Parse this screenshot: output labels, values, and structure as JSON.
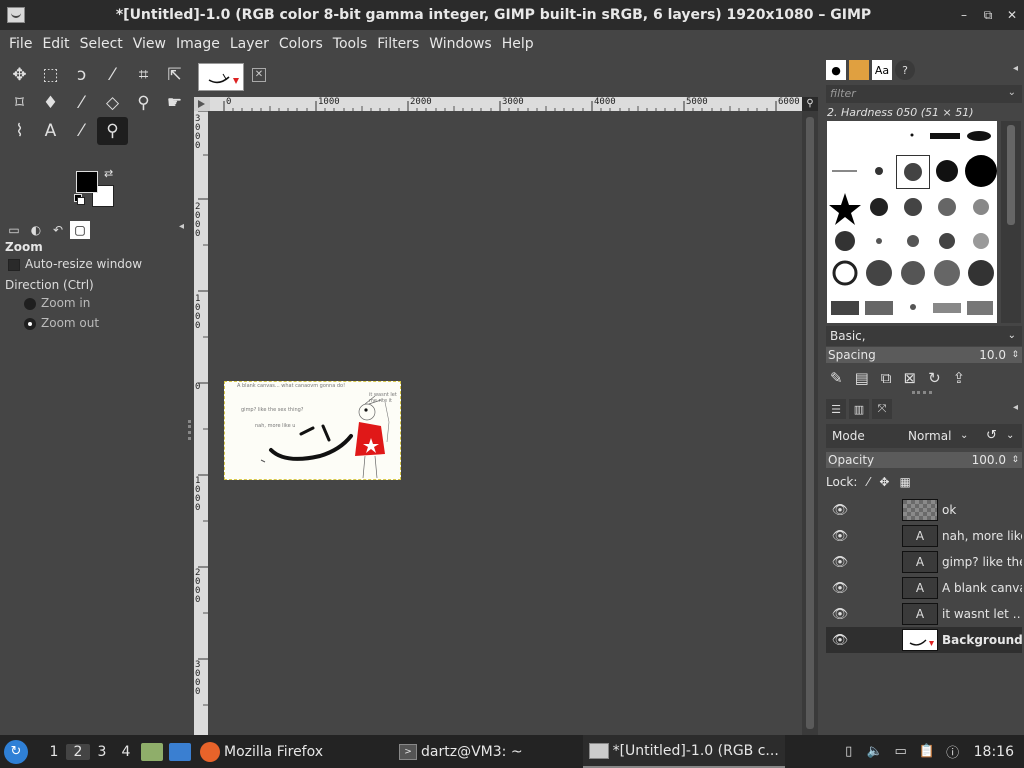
{
  "window": {
    "title": "*[Untitled]-1.0 (RGB color 8-bit gamma integer, GIMP built-in sRGB, 6 layers) 1920x1080 – GIMP",
    "minimize": "–",
    "restore": "⧉",
    "close": "✕"
  },
  "menu": [
    "File",
    "Edit",
    "Select",
    "View",
    "Image",
    "Layer",
    "Colors",
    "Tools",
    "Filters",
    "Windows",
    "Help"
  ],
  "tool_options": {
    "title": "Zoom",
    "auto_resize": "Auto-resize window",
    "direction_label": "Direction  (Ctrl)",
    "zoom_in": "Zoom in",
    "zoom_out": "Zoom out",
    "selected_direction": "zoom_out"
  },
  "ruler": {
    "h_ticks": [
      "0",
      "1000",
      "2000",
      "3000",
      "4000",
      "5000",
      "6000"
    ],
    "v_ticks": [
      "3000",
      "2000",
      "1000",
      "0",
      "1000",
      "2000",
      "3000"
    ]
  },
  "image_text": {
    "line1": "A blank canvas... what canaovm gonna do!",
    "line2": "gimp? like the sex thing?",
    "line3": "nah, more like u",
    "line4": "it wasnt let me rite it"
  },
  "brushes": {
    "filter_placeholder": "filter",
    "current": "2. Hardness 050 (51 × 51)",
    "tag": "Basic,",
    "spacing_label": "Spacing",
    "spacing_value": "10.0"
  },
  "layers": {
    "mode_label": "Mode",
    "mode_value": "Normal",
    "opacity_label": "Opacity",
    "opacity_value": "100.0",
    "lock_label": "Lock:",
    "items": [
      {
        "name": "ok",
        "type": "checker"
      },
      {
        "name": "nah, more like",
        "type": "text"
      },
      {
        "name": "gimp? like the",
        "type": "text"
      },
      {
        "name": "A blank canva",
        "type": "text"
      },
      {
        "name": "it wasnt let …",
        "type": "text"
      },
      {
        "name": "Background",
        "type": "image"
      }
    ]
  },
  "taskbar": {
    "workspaces": [
      "1",
      "2",
      "3",
      "4"
    ],
    "current_workspace": "2",
    "firefox": "Mozilla Firefox",
    "terminal": "dartz@VM3: ~",
    "gimp": "*[Untitled]-1.0 (RGB c...",
    "clock": "18:16"
  }
}
